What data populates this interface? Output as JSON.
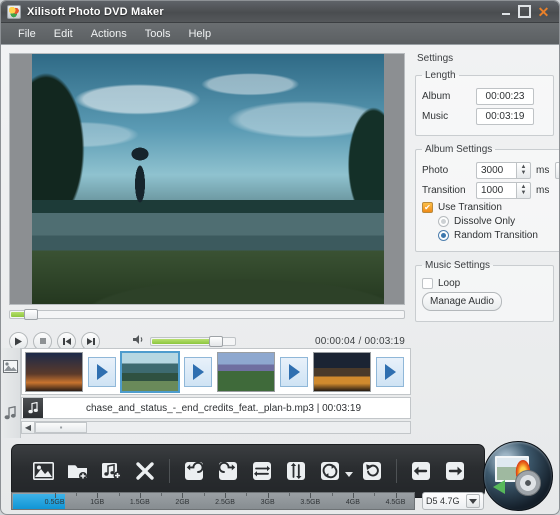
{
  "window": {
    "title": "Xilisoft Photo DVD Maker",
    "logo_icon": "app-logo-icon",
    "minimize_label": "Minimize",
    "maximize_label": "Maximize",
    "close_label": "Close"
  },
  "menubar": {
    "items": [
      {
        "label": "File"
      },
      {
        "label": "Edit"
      },
      {
        "label": "Actions"
      },
      {
        "label": "Tools"
      },
      {
        "label": "Help"
      }
    ]
  },
  "player": {
    "play_icon": "play-icon",
    "stop_icon": "stop-icon",
    "prev_icon": "previous-track-icon",
    "next_icon": "next-track-icon",
    "volume_icon": "speaker-icon",
    "timecode": "00:00:04 / 00:03:19",
    "seek_position_percent": 4,
    "volume_percent": 67
  },
  "settings": {
    "heading": "Settings",
    "length": {
      "legend": "Length",
      "album_label": "Album",
      "album_value": "00:00:23",
      "music_label": "Music",
      "music_value": "00:03:19"
    },
    "album": {
      "legend": "Album Settings",
      "photo_label": "Photo",
      "photo_value": "3000",
      "photo_unit": "ms",
      "photo_music_icon": "music-note-icon",
      "transition_label": "Transition",
      "transition_value": "1000",
      "transition_unit": "ms",
      "use_transition_label": "Use Transition",
      "use_transition_checked": true,
      "dissolve_label": "Dissolve Only",
      "dissolve_selected": false,
      "random_label": "Random Transition",
      "random_selected": true
    },
    "music": {
      "legend": "Music Settings",
      "loop_label": "Loop",
      "loop_checked": false,
      "manage_audio_label": "Manage Audio"
    }
  },
  "timeline": {
    "photo_track_icon": "photo-track-icon",
    "music_track_icon": "music-track-icon",
    "thumbnails": [
      {
        "name": "photo-thumb-1",
        "selected": false
      },
      {
        "name": "photo-thumb-2",
        "selected": true
      },
      {
        "name": "photo-thumb-3",
        "selected": false
      },
      {
        "name": "photo-thumb-4",
        "selected": false
      }
    ],
    "transition_icon": "transition-arrow-icon",
    "audio_icon": "music-note-icon",
    "audio_track_label": "chase_and_status_-_end_credits_feat._plan-b.mp3 | 00:03:19",
    "scroll_left_icon": "scroll-left-icon"
  },
  "toolbar": {
    "buttons": [
      {
        "name": "add-photo-button",
        "icon": "add-photo-icon",
        "label": "Add Photo"
      },
      {
        "name": "add-folder-button",
        "icon": "add-folder-icon",
        "label": "Add Photo Folder"
      },
      {
        "name": "add-music-button",
        "icon": "add-music-icon",
        "label": "Add Music"
      },
      {
        "name": "delete-button",
        "icon": "delete-x-icon",
        "label": "Delete"
      },
      {
        "name": "rotate-left-button",
        "icon": "rotate-left-icon",
        "label": "Rotate Left"
      },
      {
        "name": "rotate-right-button",
        "icon": "rotate-right-icon",
        "label": "Rotate Right"
      },
      {
        "name": "flip-horizontal-button",
        "icon": "flip-horizontal-icon",
        "label": "Flip Horizontal"
      },
      {
        "name": "flip-vertical-button",
        "icon": "flip-vertical-icon",
        "label": "Flip Vertical"
      },
      {
        "name": "effects-button",
        "icon": "effects-icon",
        "label": "Effects"
      },
      {
        "name": "undo-button",
        "icon": "undo-icon",
        "label": "Undo"
      },
      {
        "name": "move-back-button",
        "icon": "arrow-left-icon",
        "label": "Move Back"
      },
      {
        "name": "move-forward-button",
        "icon": "arrow-right-icon",
        "label": "Move Forward"
      }
    ],
    "burn_label": "Burn",
    "burn_icon": "burn-disc-icon"
  },
  "capacity": {
    "used_percent": 12,
    "ticks": [
      {
        "label": "0.5GB",
        "pos": 10.6
      },
      {
        "label": "1GB",
        "pos": 21.2
      },
      {
        "label": "1.5GB",
        "pos": 31.8
      },
      {
        "label": "2GB",
        "pos": 42.4
      },
      {
        "label": "2.5GB",
        "pos": 53.0
      },
      {
        "label": "3GB",
        "pos": 63.6
      },
      {
        "label": "3.5GB",
        "pos": 74.2
      },
      {
        "label": "4GB",
        "pos": 84.8
      },
      {
        "label": "4.5GB",
        "pos": 95.4
      }
    ],
    "disc_type": "D5 4.7G"
  }
}
